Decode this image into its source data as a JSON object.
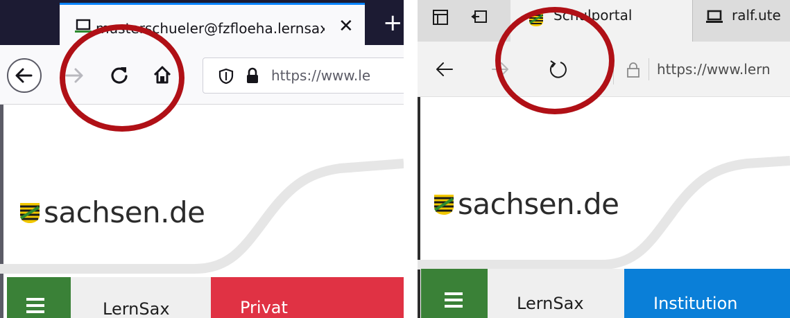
{
  "firefox": {
    "tab_title": "musterschueler@fzfloeha.lernsax",
    "tab_close": "✕",
    "new_tab": "+",
    "url": "https://www.le",
    "brand": "sachsen.de",
    "nav": {
      "lernsax": "LernSax",
      "privat": "Privat"
    },
    "colors": {
      "privat_tab": "#e03244",
      "menu_button": "#3a8137",
      "highlight_circle": "#b01016"
    }
  },
  "edge": {
    "tab_active": "Schulportal",
    "tab_other": "ralf.ute",
    "url": "https://www.lern",
    "brand": "sachsen.de",
    "nav": {
      "lernsax": "LernSax",
      "institution": "Institution"
    },
    "colors": {
      "institution_tab": "#0a7fd8",
      "menu_button": "#3a8137",
      "highlight_circle": "#b01016"
    }
  },
  "icons": [
    "back-arrow-icon",
    "forward-arrow-icon",
    "reload-icon",
    "home-icon",
    "shield-icon",
    "lock-icon",
    "menu-icon",
    "coat-of-arms-icon"
  ]
}
